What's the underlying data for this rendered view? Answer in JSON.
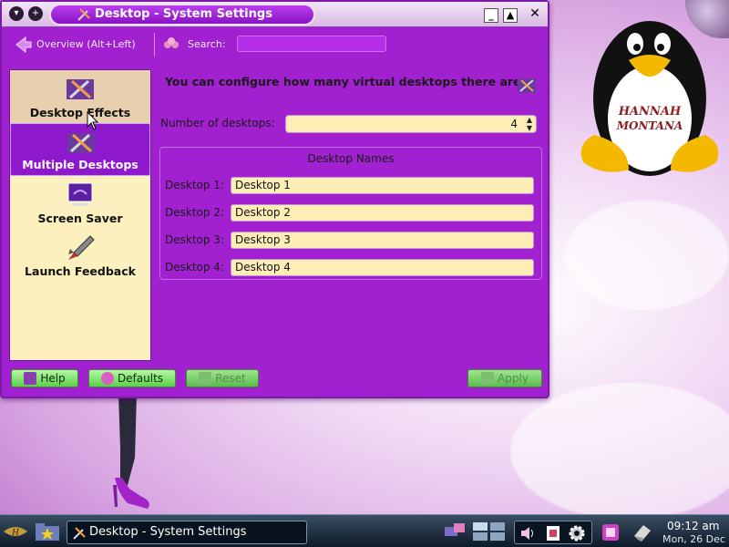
{
  "window": {
    "title": "Desktop - System Settings",
    "controls": [
      "minimize",
      "maximize",
      "close"
    ]
  },
  "toolbar": {
    "overview_label": "Overview (Alt+Left)",
    "search_label": "Search:",
    "search_value": ""
  },
  "sidebar": {
    "items": [
      {
        "label": "Desktop Effects",
        "state": "hover"
      },
      {
        "label": "Multiple Desktops",
        "state": "selected"
      },
      {
        "label": "Screen Saver",
        "state": "normal"
      },
      {
        "label": "Launch Feedback",
        "state": "normal"
      }
    ]
  },
  "main": {
    "heading": "You can configure how many virtual desktops there are.",
    "number_label": "Number of desktops:",
    "number_value": "4",
    "names_group_title": "Desktop Names",
    "desktops": [
      {
        "label": "Desktop 1:",
        "value": "Desktop 1"
      },
      {
        "label": "Desktop 2:",
        "value": "Desktop 2"
      },
      {
        "label": "Desktop 3:",
        "value": "Desktop 3"
      },
      {
        "label": "Desktop 4:",
        "value": "Desktop 4"
      }
    ]
  },
  "buttons": {
    "help": "Help",
    "defaults": "Defaults",
    "reset": "Reset",
    "apply": "Apply"
  },
  "taskbar": {
    "task_label": "Desktop - System Settings",
    "time": "09:12 am",
    "date": "Mon, 26 Dec"
  },
  "colors": {
    "window_bg": "#a120cf",
    "sidebar_bg": "#fdf0bf",
    "field_bg": "#fdeeb6",
    "button_green": "#5ad14b"
  }
}
